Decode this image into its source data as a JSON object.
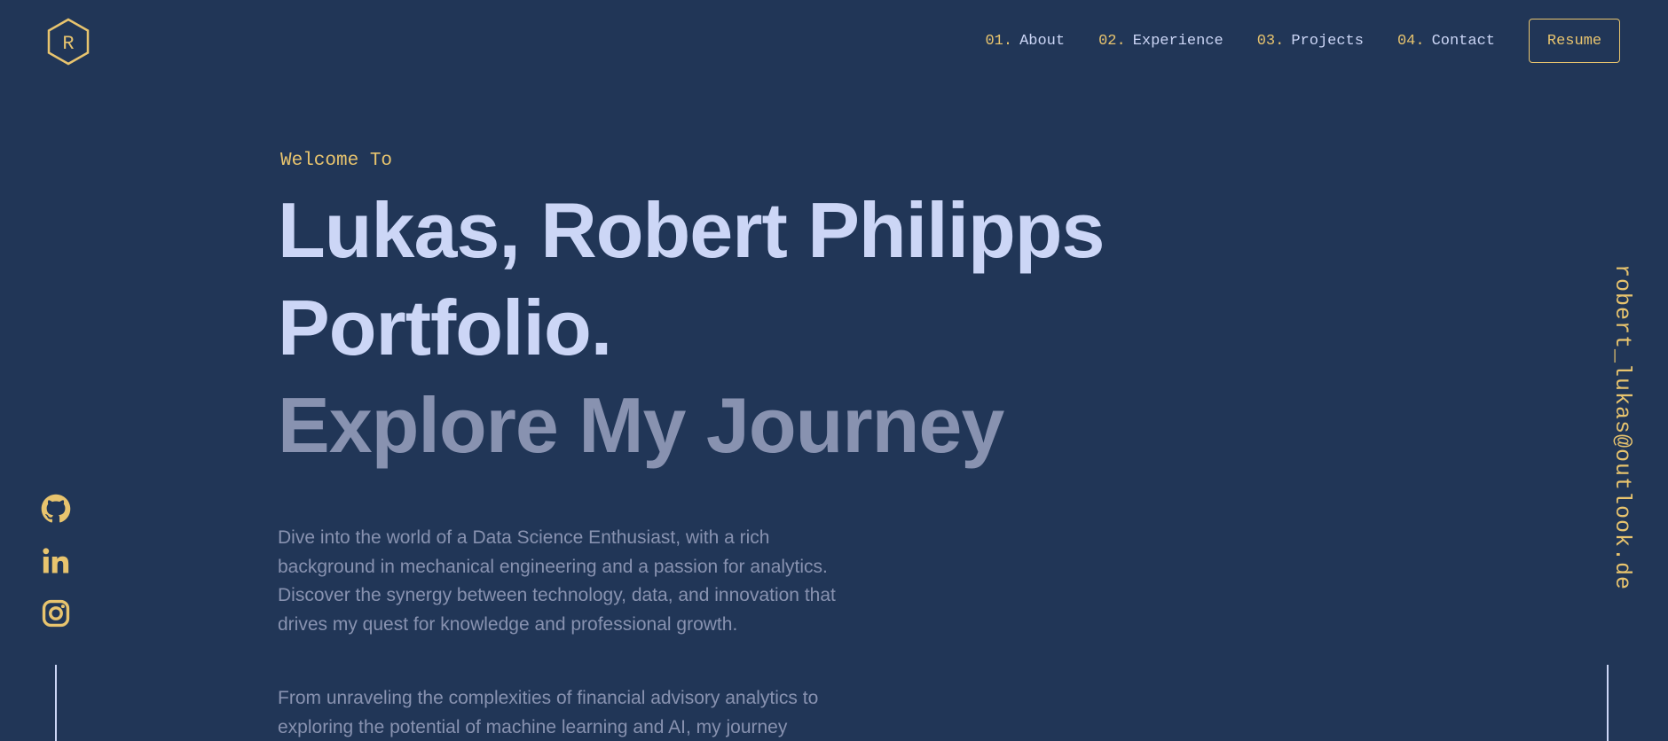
{
  "logo": {
    "letter": "R"
  },
  "nav": {
    "items": [
      {
        "num": "01.",
        "label": "About"
      },
      {
        "num": "02.",
        "label": "Experience"
      },
      {
        "num": "03.",
        "label": "Projects"
      },
      {
        "num": "04.",
        "label": "Contact"
      }
    ],
    "resume_label": "Resume"
  },
  "hero": {
    "welcome": "Welcome To",
    "title_line1": "Lukas, Robert Philipps",
    "title_line2": "Portfolio.",
    "subtitle": "Explore My Journey",
    "paragraph1": "Dive into the world of a Data Science Enthusiast, with a rich background in mechanical engineering and a passion for analytics. Discover the synergy between technology, data, and innovation that drives my quest for knowledge and professional growth.",
    "paragraph2": "From unraveling the complexities of financial advisory analytics to exploring the potential of machine learning and AI, my journey"
  },
  "side": {
    "email": "robert_lukas@outlook.de",
    "socials": [
      "github-icon",
      "linkedin-icon",
      "instagram-icon"
    ]
  },
  "colors": {
    "background": "#213657",
    "accent": "#e8c46e",
    "heading": "#ccd6f6",
    "muted": "#8892b0"
  }
}
